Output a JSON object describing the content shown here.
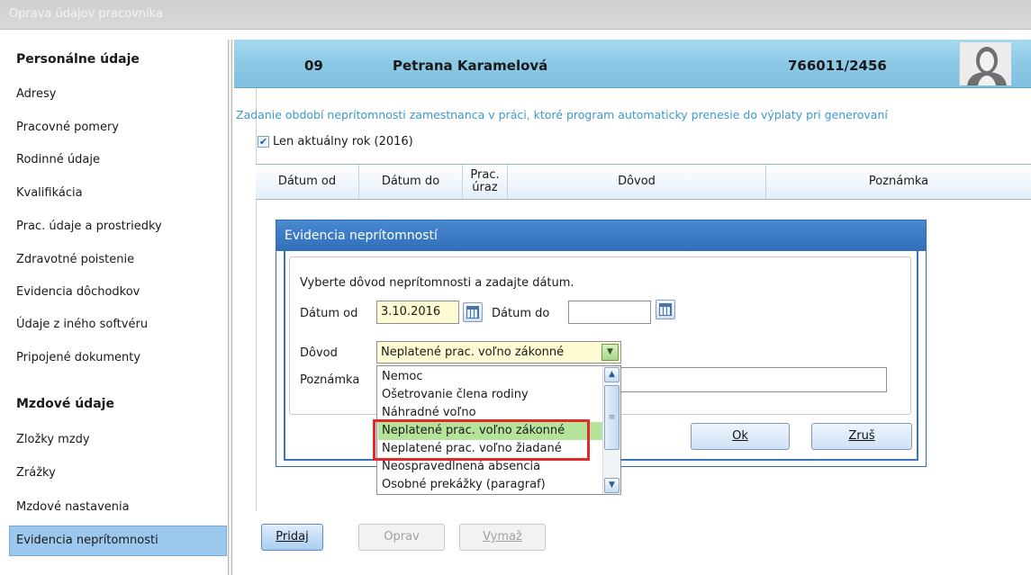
{
  "window": {
    "title": "Oprava údajov pracovníka"
  },
  "sidebar": {
    "section1_title": "Personálne údaje",
    "section1_items": [
      "Adresy",
      "Pracovné pomery",
      "Rodinné údaje",
      "Kvalifikácia",
      "Prac. údaje a prostriedky",
      "Zdravotné poistenie",
      "Evidencia dôchodkov",
      "Údaje z iného softvéru",
      "Pripojené dokumenty"
    ],
    "section2_title": "Mzdové údaje",
    "section2_items": [
      "Zložky mzdy",
      "Zrážky",
      "Mzdové nastavenia",
      "Evidencia neprítomnosti"
    ],
    "active_item": "Evidencia neprítomnosti"
  },
  "employee": {
    "id": "09",
    "name": "Petrana Karamelová",
    "birth_number": "766011/2456"
  },
  "main": {
    "info_text": "Zadanie období neprítomnosti zamestnanca v práci, ktoré program automaticky prenesie do výplaty pri generovaní",
    "current_year_checkbox": {
      "label": "Len aktuálny rok (2016)",
      "checked": true
    },
    "table_headers": [
      "Dátum od",
      "Dátum do",
      "Prac.\núraz",
      "Dôvod",
      "Poznámka"
    ],
    "buttons": {
      "add": "Pridaj",
      "edit": "Oprav",
      "delete": "Vymaž"
    }
  },
  "dialog": {
    "title": "Evidencia neprítomností",
    "instruction": "Vyberte dôvod neprítomnosti a zadajte dátum.",
    "date_from_label": "Dátum od",
    "date_from_value": "3.10.2016",
    "date_to_label": "Dátum do",
    "date_to_value": "",
    "reason_label": "Dôvod",
    "reason_value": "Neplatené prac. voľno zákonné",
    "note_label": "Poznámka",
    "note_value": "",
    "reason_options": [
      "Nemoc",
      "Ošetrovanie člena rodiny",
      "Náhradné voľno",
      "Neplatené prac. voľno zákonné",
      "Neplatené prac. voľno žiadané",
      "Neospravedlnená absencia",
      "Osobné prekážky (paragraf)"
    ],
    "selected_option_index": 3,
    "ok_label": "Ok",
    "cancel_label": "Zruš"
  },
  "colors": {
    "header_blue": "#8cc9e6",
    "dialog_title_blue": "#3d7cc6",
    "selected_green": "#b6e39a",
    "highlight_red": "#e02a2a",
    "info_text_blue": "#3f97d1"
  }
}
